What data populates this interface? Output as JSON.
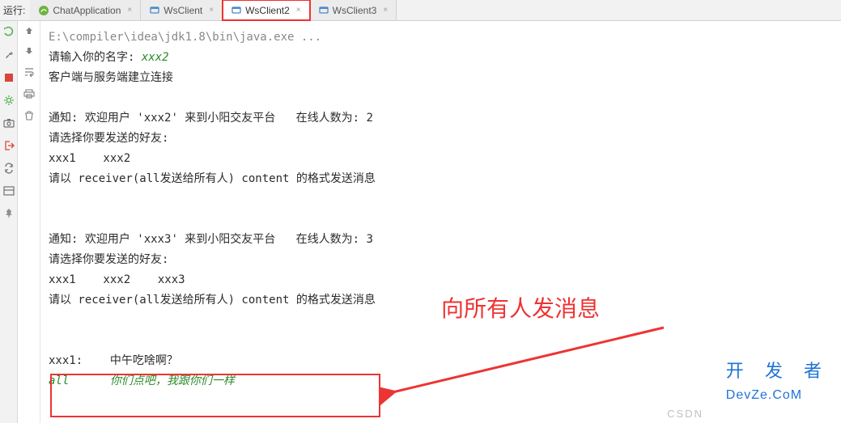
{
  "toolbar": {
    "run_label": "运行:"
  },
  "tabs": [
    {
      "label": "ChatApplication",
      "type": "spring"
    },
    {
      "label": "WsClient",
      "type": "app"
    },
    {
      "label": "WsClient2",
      "type": "app",
      "active": true,
      "highlighted": true
    },
    {
      "label": "WsClient3",
      "type": "app"
    }
  ],
  "console": {
    "path": "E:\\compiler\\idea\\jdk1.8\\bin\\java.exe ...",
    "prompt_name_label": "请输入你的名字: ",
    "entered_name": "xxx2",
    "connect_msg": "客户端与服务端建立连接",
    "notice1_prefix": "通知: 欢迎用户 ",
    "notice1_user": "'xxx2'",
    "notice1_suffix": " 来到小阳交友平台   在线人数为: 2",
    "select_friend": "请选择你要发送的好友:",
    "friends1": "xxx1    xxx2",
    "format_msg": "请以 receiver(all发送给所有人) content 的格式发送消息",
    "notice2_prefix": "通知: 欢迎用户 ",
    "notice2_user": "'xxx3'",
    "notice2_suffix": " 来到小阳交友平台   在线人数为: 3",
    "friends2": "xxx1    xxx2    xxx3",
    "incoming_from": "xxx1:    中午吃啥啊？",
    "input_receiver": "all",
    "input_content": "你们点吧，我跟你们一样"
  },
  "annotation": {
    "text": "向所有人发消息"
  },
  "watermark": {
    "csdn": "CSDN",
    "logo": "开 发 者",
    "url": "DevZe.CoM"
  },
  "icons": {
    "rerun": "rerun-icon",
    "wrench": "wrench-icon",
    "stop": "stop-icon",
    "cog": "cog-icon",
    "camera": "camera-icon",
    "exit": "exit-icon",
    "cycle": "cycle-icon",
    "layout": "layout-icon",
    "pin": "pin-icon",
    "up": "up-icon",
    "down": "down-icon",
    "wrap": "wrap-icon",
    "print": "print-icon",
    "trash": "trash-icon"
  }
}
